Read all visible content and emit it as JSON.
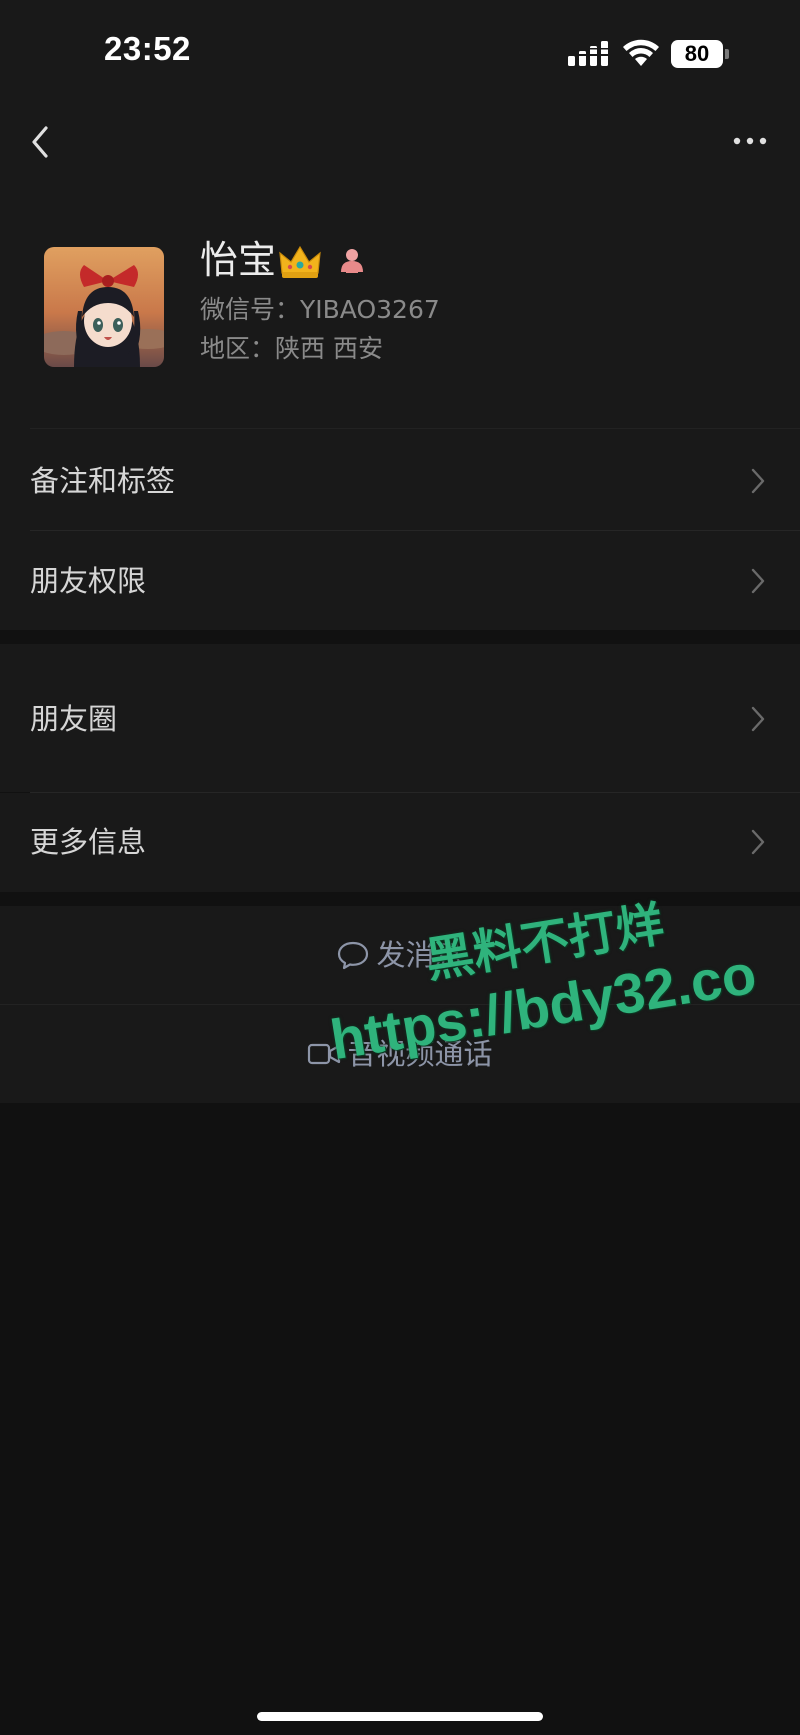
{
  "status_bar": {
    "time": "23:52",
    "battery": "80",
    "icons": [
      "signal-icon",
      "wifi-icon",
      "battery-icon"
    ]
  },
  "nav": {
    "back_icon": "back-chevron-icon",
    "more_icon": "more-dots-icon"
  },
  "profile": {
    "name": "怡宝",
    "name_emoji": "crown-icon",
    "status_icon": "person-status-icon",
    "wechat_id": "微信号：YIBAO3267",
    "region": "地区：陕西 西安"
  },
  "menu": {
    "items": [
      {
        "label": "备注和标签"
      },
      {
        "label": "朋友权限"
      },
      {
        "label": "朋友圈"
      },
      {
        "label": "更多信息"
      }
    ]
  },
  "actions": {
    "send_message": "发消息",
    "av_call": "音视频通话"
  },
  "watermark": {
    "line1": "黑料不打烊",
    "line2": "https://bdy32.co"
  },
  "colors": {
    "background": "#111111",
    "panel": "#191919",
    "action_text": "#8d95a8",
    "watermark": "#2fb37c"
  }
}
